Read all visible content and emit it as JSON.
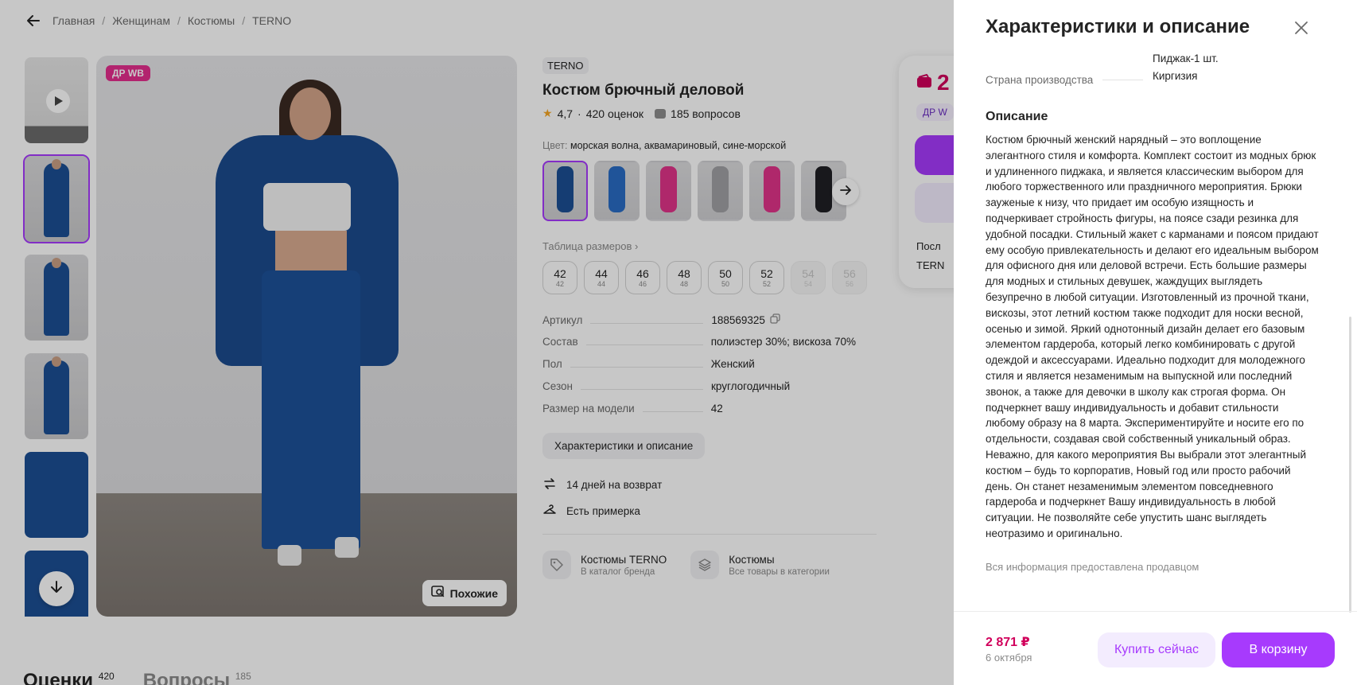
{
  "breadcrumb": {
    "items": [
      "Главная",
      "Женщинам",
      "Костюмы",
      "TERNO"
    ],
    "separator": "/"
  },
  "gallery": {
    "badge": "ДР WB",
    "similar_button": "Похожие"
  },
  "product": {
    "brand": "TERNO",
    "title": "Костюм брючный деловой",
    "rating": "4,7",
    "rating_sep": "·",
    "reviews": "420 оценок",
    "questions": "185 вопросов",
    "color_label": "Цвет:",
    "color_value": "морская волна, аквамариновый, сине-морской",
    "color_thumb_colors": [
      "#1c4f94",
      "#2a6cc4",
      "#e0348a",
      "#a0a0a4",
      "#e0348a",
      "#1f1f24"
    ],
    "size_table_link": "Таблица размеров",
    "sizes": [
      {
        "size": "42",
        "ru": "42",
        "available": true
      },
      {
        "size": "44",
        "ru": "44",
        "available": true
      },
      {
        "size": "46",
        "ru": "46",
        "available": true
      },
      {
        "size": "48",
        "ru": "48",
        "available": true
      },
      {
        "size": "50",
        "ru": "50",
        "available": true
      },
      {
        "size": "52",
        "ru": "52",
        "available": true
      },
      {
        "size": "54",
        "ru": "54",
        "available": false
      },
      {
        "size": "56",
        "ru": "56",
        "available": false
      }
    ],
    "params": [
      {
        "key": "Артикул",
        "value": "188569325"
      },
      {
        "key": "Состав",
        "value": "полиэстер 30%; вискоза 70%"
      },
      {
        "key": "Пол",
        "value": "Женский"
      },
      {
        "key": "Сезон",
        "value": "круглогодичный"
      },
      {
        "key": "Размер на модели",
        "value": "42"
      }
    ],
    "chars_button": "Характеристики и описание",
    "features": [
      "14 дней на возврат",
      "Есть примерка"
    ],
    "brand_links": [
      {
        "title": "Костюмы TERNO",
        "subtitle": "В каталог бренда",
        "icon": "tag-icon"
      },
      {
        "title": "Костюмы",
        "subtitle": "Все товары в категории",
        "icon": "layers-icon"
      }
    ]
  },
  "buy_card": {
    "price_partial": "2",
    "dr_chip": "ДР W",
    "line1": "Посл",
    "line2": "TERN"
  },
  "bottom_tabs": [
    {
      "label": "Оценки",
      "count": "420"
    },
    {
      "label": "Вопросы",
      "count": "185"
    }
  ],
  "drawer": {
    "title": "Характеристики и описание",
    "rows": [
      {
        "key": "",
        "value": "Пиджак-1 шт."
      },
      {
        "key": "Страна производства",
        "value": "Киргизия"
      }
    ],
    "description_heading": "Описание",
    "description": "Костюм брючный женский нарядный – это воплощение элегантного стиля и комфорта. Комплект состоит из модных брюк и удлиненного пиджака, и является классическим выбором для любого торжественного или праздничного мероприятия. Брюки зауженые к низу, что придает им особую изящность и подчеркивает стройность фигуры, на поясе сзади резинка для удобной посадки. Стильный жакет с карманами и поясом придают ему особую привлекательность и делают его идеальным выбором для офисного дня или деловой встречи. Есть большие размеры для модных и стильных девушек, жаждущих выглядеть безупречно в любой ситуации. Изготовленный из прочной ткани, вискозы, этот летний костюм также подходит для носки весной, осенью и зимой. Яркий однотонный дизайн делает его базовым элементом гардероба, который легко комбинировать с другой одеждой и аксессуарами. Идеально подходит для молодежного стиля и является незаменимым на выпускной или последний звонок, а также для девочки в школу как строгая форма. Он подчеркнет вашу индивидуальность и добавит стильности любому образу на 8 марта. Экспериментируйте и носите его по отдельности, создавая свой собственный уникальный образ. Неважно, для какого мероприятия Вы выбрали этот элегантный костюм – будь то корпоратив, Новый год или просто рабочий день. Он станет незаменимым элементом повседневного гардероба и подчеркнет Вашу индивидуальность в любой ситуации. Не позволяйте себе упустить шанс выглядеть неотразимо и оригинально.",
    "note": "Вся информация предоставлена продавцом",
    "footer_price": "2 871 ₽",
    "footer_date": "6 октября",
    "buy_now": "Купить сейчас",
    "add_to_cart": "В корзину"
  },
  "colors": {
    "accent": "#a73afd",
    "price": "#d1005b",
    "badge": "#e42e8e"
  }
}
